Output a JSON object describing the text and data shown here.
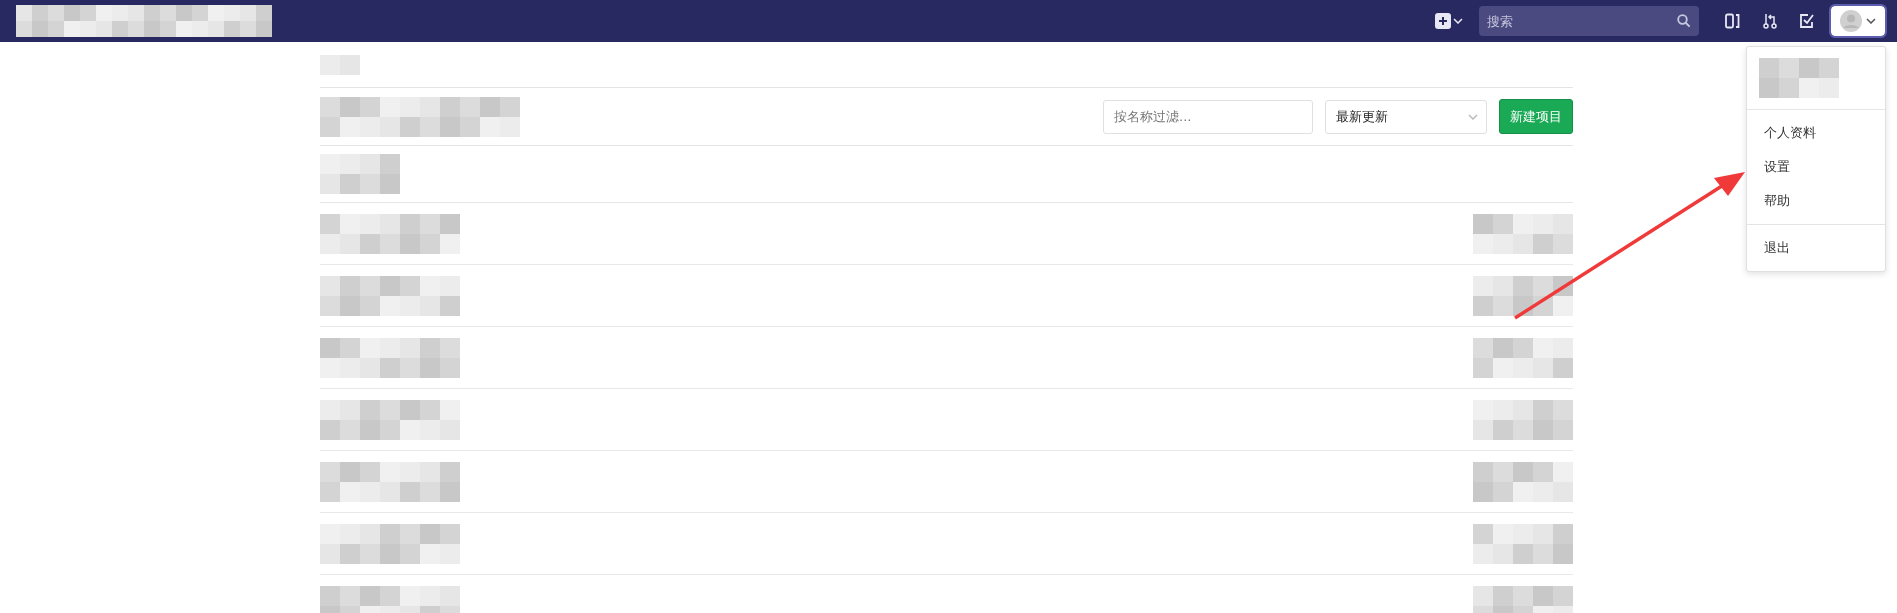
{
  "header": {
    "search": {
      "placeholder": "搜索"
    }
  },
  "filter": {
    "placeholder": "按名称过滤...",
    "sort": "最新更新",
    "new_button": "新建项目"
  },
  "project_rows": [
    {
      "kind": "redacted"
    },
    {
      "kind": "redacted"
    },
    {
      "kind": "redacted"
    },
    {
      "kind": "redacted"
    },
    {
      "kind": "redacted"
    },
    {
      "kind": "redacted"
    },
    {
      "kind": "redacted"
    }
  ],
  "user_menu": {
    "expanded": true,
    "items": [
      "个人资料",
      "设置",
      "帮助"
    ],
    "signout": "退出"
  },
  "annotations": [
    {
      "kind": "arrow"
    }
  ]
}
